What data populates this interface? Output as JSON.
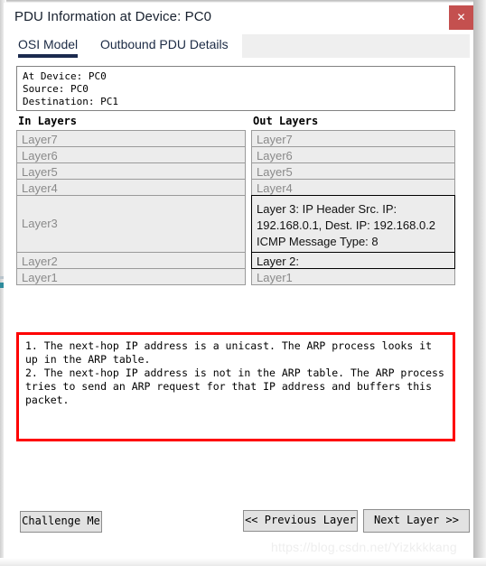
{
  "window": {
    "title": "PDU Information at Device: PC0",
    "close_label": "✕"
  },
  "tabs": [
    {
      "label": "OSI Model",
      "active": true
    },
    {
      "label": "Outbound PDU Details",
      "active": false
    }
  ],
  "device_info": {
    "at_device": "At Device: PC0",
    "source": "Source: PC0",
    "destination": "Destination: PC1"
  },
  "in_layers": {
    "title": "In Layers",
    "rows": [
      {
        "label": "Layer7",
        "active": false,
        "size": "small"
      },
      {
        "label": "Layer6",
        "active": false,
        "size": "small"
      },
      {
        "label": "Layer5",
        "active": false,
        "size": "small"
      },
      {
        "label": "Layer4",
        "active": false,
        "size": "small"
      },
      {
        "label": "Layer3",
        "active": false,
        "size": "big"
      },
      {
        "label": "Layer2",
        "active": false,
        "size": "small"
      },
      {
        "label": "Layer1",
        "active": false,
        "size": "small"
      }
    ]
  },
  "out_layers": {
    "title": "Out Layers",
    "rows": [
      {
        "label": "Layer7",
        "active": false,
        "size": "small"
      },
      {
        "label": "Layer6",
        "active": false,
        "size": "small"
      },
      {
        "label": "Layer5",
        "active": false,
        "size": "small"
      },
      {
        "label": "Layer4",
        "active": false,
        "size": "small"
      },
      {
        "label": "Layer 3: IP Header Src. IP: 192.168.0.1, Dest. IP: 192.168.0.2 ICMP Message Type: 8",
        "active": true,
        "size": "text"
      },
      {
        "label": "Layer 2:",
        "active": true,
        "size": "small"
      },
      {
        "label": "Layer1",
        "active": false,
        "size": "small"
      }
    ]
  },
  "description": "1. The next-hop IP address is a unicast. The ARP process looks it up in the ARP table.\n2. The next-hop IP address is not in the ARP table. The ARP process tries to send an ARP request for that IP address and buffers this packet.",
  "buttons": {
    "challenge": "Challenge Me",
    "previous": "<< Previous Layer",
    "next": "Next Layer >>"
  },
  "watermark": "https://blog.csdn.net/Yizkkkkang",
  "colors": {
    "accent": "#1b2a4e",
    "close_button": "#c4504f",
    "highlight_border": "#fe0000",
    "layer_bg": "#ececec",
    "layer_text_inactive": "#8a8a8a"
  }
}
